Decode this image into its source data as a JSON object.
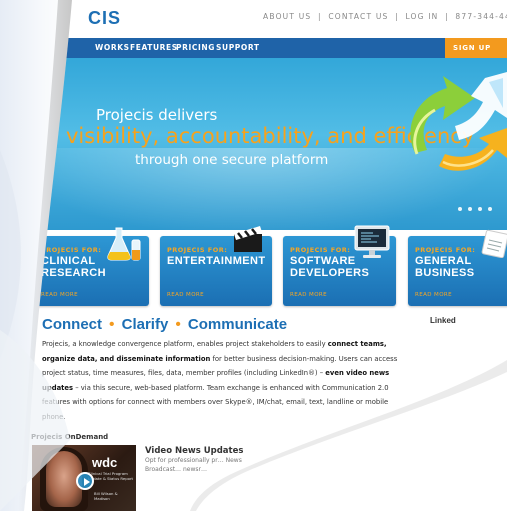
{
  "header": {
    "logo_text": "CIS",
    "top_links": [
      "ABOUT US",
      "CONTACT US",
      "LOG IN"
    ],
    "separator": "|",
    "phone": "877-344-44"
  },
  "nav": {
    "items": [
      "WORKS",
      "FEATURES",
      "PRICING",
      "SUPPORT"
    ],
    "signup_label": "SIGN UP NOW"
  },
  "hero": {
    "line1": "Projecis delivers",
    "line2": "visibility, accountability, and efficiency",
    "line3": "through one secure platform",
    "slide_count": 4
  },
  "cards": [
    {
      "for_label": "PROJECIS FOR:",
      "title_line1": "CLINICAL",
      "title_line2": "RESEARCH",
      "more_label": "READ MORE",
      "icon": "flask-icon"
    },
    {
      "for_label": "PROJECIS FOR:",
      "title_line1": "ENTERTAINMENT",
      "title_line2": "",
      "more_label": "READ MORE",
      "icon": "clapperboard-icon"
    },
    {
      "for_label": "PROJECIS FOR:",
      "title_line1": "SOFTWARE",
      "title_line2": "DEVELOPERS",
      "more_label": "READ MORE",
      "icon": "monitor-icon"
    },
    {
      "for_label": "PROJECIS FOR:",
      "title_line1": "GENERAL",
      "title_line2": "BUSINESS",
      "more_label": "READ MORE",
      "icon": "notepad-icon"
    }
  ],
  "main": {
    "heading_parts": [
      "Connect",
      "Clarify",
      "Communicate"
    ],
    "heading_bullet": "•",
    "body": {
      "p1": "Projecis, a knowledge convergence platform, enables project stakeholders to easily ",
      "b1": "connect teams, organize data, and disseminate information",
      "p2": " for better business decision-making. Users can access project status, time measures, files, data, member profiles (including LinkedIn®) – ",
      "b2": "even video news updates",
      "p3": " – via this secure, web-based platform. Team exchange is enhanced with Communication 2.0 features with options for connect",
      "p4": " with members over Skype®, IM/chat, email, text, landline or mobile phone."
    }
  },
  "sidebar": {
    "linkedin_label": "Linked"
  },
  "ondemand": {
    "section_title": "Projecis OnDemand",
    "video_title": "Video News Updates",
    "video_text": "Opt for professionally pr… News Broadcast… newsr…",
    "thumb_logo": "wdc",
    "thumb_sub1": "Clinical Trial Program Update & Status Report",
    "thumb_sub2": "Bill Wilson & Madison"
  },
  "colors": {
    "brand_blue": "#1d6fb4",
    "nav_blue": "#1f63a8",
    "accent_orange": "#f39a1e",
    "hero_blue": "#3aaee0"
  }
}
